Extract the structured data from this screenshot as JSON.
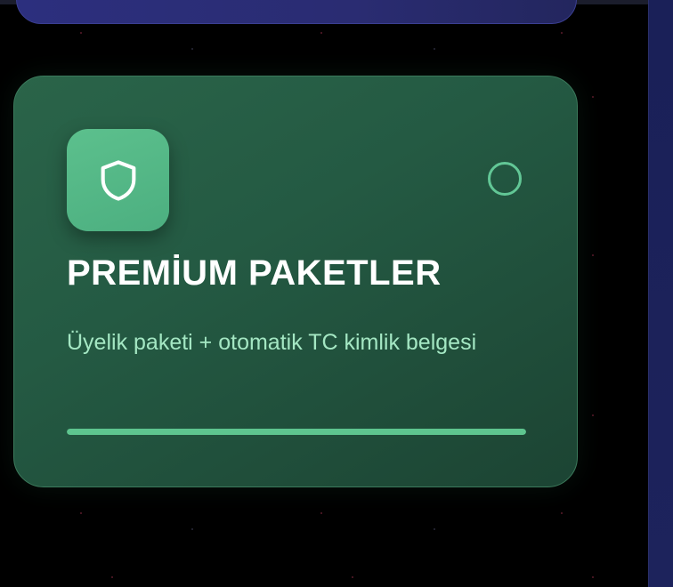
{
  "card": {
    "title": "PREMİUM PAKETLER",
    "description": "Üyelik paketi + otomatik TC kimlik belgesi",
    "icon": "shield-icon",
    "selected": false,
    "progress": 1.0
  },
  "colors": {
    "background": "#000000",
    "card_gradient_start": "#2a6449",
    "card_gradient_end": "#1c4433",
    "icon_box": "#5cc08d",
    "accent": "#5ec58f",
    "description_text": "#a4e7c3",
    "top_card": "#2c2f7e",
    "scrollbar": "#1a2058"
  }
}
